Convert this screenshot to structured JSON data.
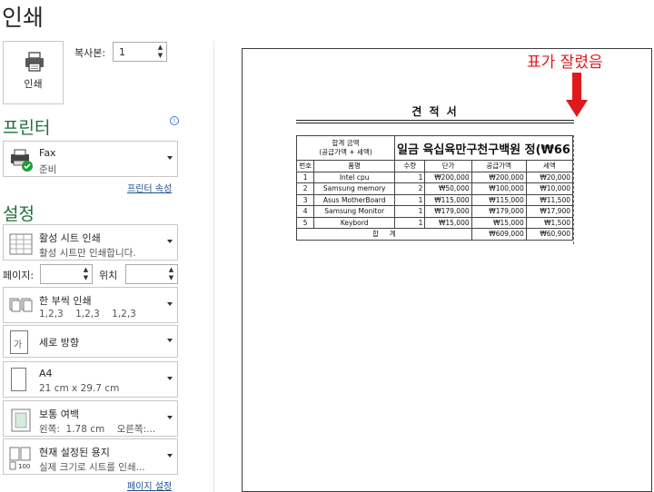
{
  "title": "인쇄",
  "print_button": {
    "label": "인쇄",
    "icon": "printer-icon"
  },
  "copies": {
    "label": "복사본:",
    "value": "1"
  },
  "printer": {
    "section_title": "프린터",
    "name": "Fax",
    "status": "준비",
    "properties_link": "프린터 속성"
  },
  "settings": {
    "section_title": "설정",
    "scope": {
      "title": "활성 시트 인쇄",
      "subtitle": "활성 시트만 인쇄합니다."
    },
    "pages_label": "페이지:",
    "to_label": "위치",
    "collate": {
      "title": "한 부씩 인쇄",
      "subtitle": "1,2,3    1,2,3    1,2,3"
    },
    "orientation": {
      "title": "세로 방향",
      "icon_glyph": "가"
    },
    "paper": {
      "title": "A4",
      "subtitle": "21 cm x 29.7 cm"
    },
    "margins": {
      "title": "보통 여백",
      "subtitle": "왼쪽:  1.78 cm    오른쪽:..."
    },
    "scaling": {
      "title": "현재 설정된 용지",
      "subtitle": "실제 크기로 시트를 인쇄...",
      "icon_text": "100"
    },
    "page_setup_link": "페이지 설정"
  },
  "preview": {
    "doc_title": "견 적 서",
    "annotation": "표가 잘렸음",
    "annotation_color": "#e0191b",
    "sum_label": "합계 금액",
    "sum_sub": "(공급가액 + 세액)",
    "sum_value": "일금 육십육만구천구백원 정(₩66",
    "headers": [
      "번호",
      "품명",
      "수량",
      "단가",
      "공급가액",
      "세액"
    ],
    "rows": [
      [
        "1",
        "Intel cpu",
        "1",
        "₩200,000",
        "₩200,000",
        "₩20,000"
      ],
      [
        "2",
        "Samsung memory",
        "2",
        "₩50,000",
        "₩100,000",
        "₩10,000"
      ],
      [
        "3",
        "Asus MotherBoard",
        "1",
        "₩115,000",
        "₩115,000",
        "₩11,500"
      ],
      [
        "4",
        "Samsung Monitor",
        "1",
        "₩179,000",
        "₩179,000",
        "₩17,900"
      ],
      [
        "5",
        "Keybord",
        "1",
        "₩15,000",
        "₩15,000",
        "₩1,500"
      ]
    ],
    "total_label": "합     계",
    "total_supply": "₩609,000",
    "total_tax": "₩60,900"
  }
}
